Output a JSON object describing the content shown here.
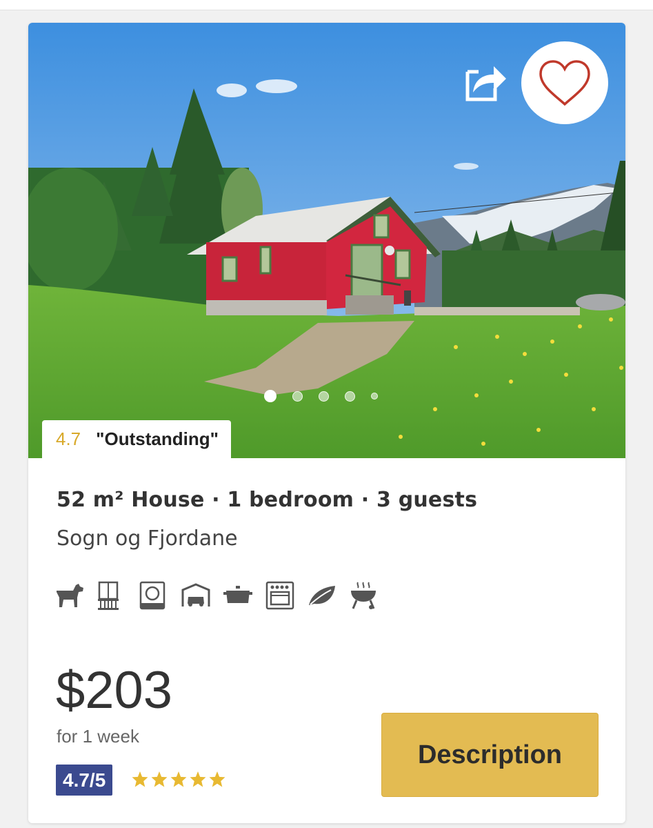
{
  "listing": {
    "rating_value": "4.7",
    "rating_label": "\"Outstanding\"",
    "title": "52 m² House · 1 bedroom · 3 guests",
    "location": "Sogn og Fjordane",
    "amenities": [
      "dog-icon",
      "balcony-icon",
      "dishwasher-icon",
      "garage-icon",
      "cooking-pot-icon",
      "oven-icon",
      "leaf-icon",
      "barbecue-icon"
    ],
    "photo": {
      "carousel_dot_count": 5,
      "active_dot": 1
    }
  },
  "pricing": {
    "price": "$203",
    "period": "for 1 week",
    "score": "4.7/5",
    "stars": 5
  },
  "actions": {
    "description_label": "Description"
  },
  "colors": {
    "accent_yellow": "#e3bb52",
    "star_yellow": "#e8b932",
    "score_badge": "#3b4a8f",
    "heart_stroke": "#c0392b"
  }
}
